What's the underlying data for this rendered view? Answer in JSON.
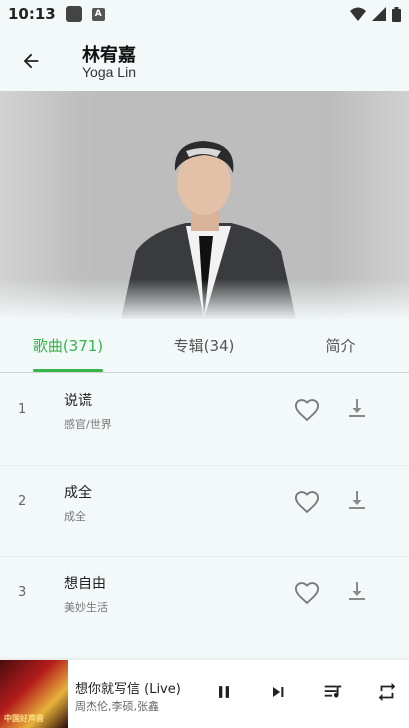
{
  "status": {
    "time": "10:13"
  },
  "header": {
    "title": "林宥嘉",
    "subtitle": "Yoga Lin"
  },
  "tabs": [
    {
      "label": "歌曲(371)",
      "active": true
    },
    {
      "label": "专辑(34)",
      "active": false
    },
    {
      "label": "简介",
      "active": false
    }
  ],
  "songs": [
    {
      "index": "1",
      "title": "说谎",
      "album": "感官/世界"
    },
    {
      "index": "2",
      "title": "成全",
      "album": "成全"
    },
    {
      "index": "3",
      "title": "想自由",
      "album": "美妙生活"
    }
  ],
  "player": {
    "title": "想你就写信 (Live)",
    "artist": "周杰伦,李硕,张鑫",
    "cover_text": "中国好声音"
  },
  "colors": {
    "accent": "#35b54a",
    "background": "#f3f8f8"
  },
  "icons": [
    "back-arrow-icon",
    "heart-icon",
    "download-icon",
    "pause-icon",
    "next-icon",
    "playlist-icon",
    "repeat-icon"
  ]
}
